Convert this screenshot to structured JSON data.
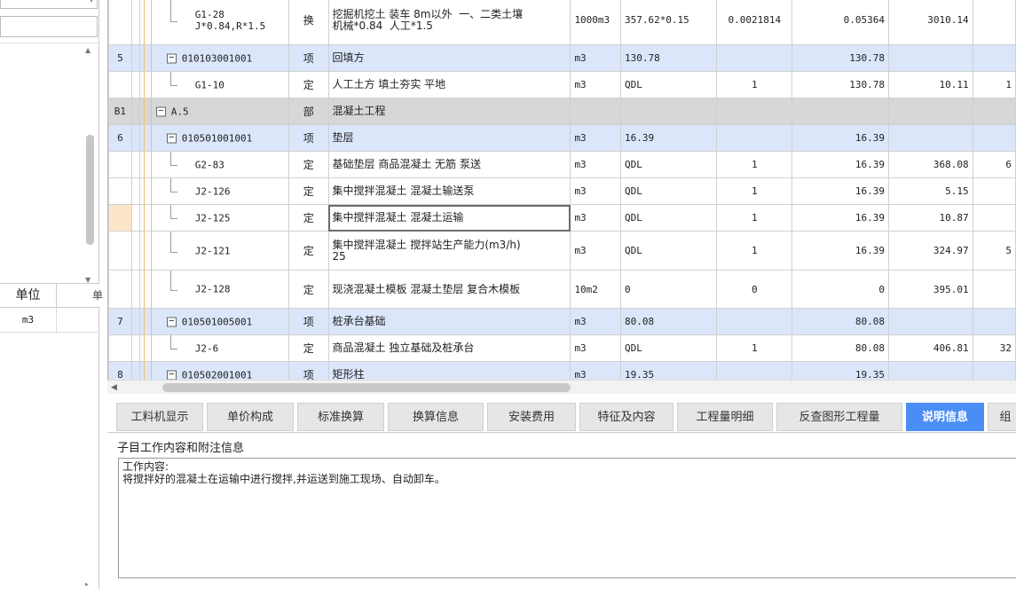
{
  "left_panel": {
    "header_unit": "单位",
    "header_second": "单",
    "row_unit": "m3"
  },
  "grid": {
    "rows": [
      {
        "idx": "",
        "code": "G1-28\nJ*0.84,R*1.5",
        "type": "换",
        "name": "挖掘机挖土 装车 8m以外  一、二类土壤\n机械*0.84  人工*1.5",
        "unit": "1000m3",
        "expr": "357.62*0.15",
        "coef": "0.0021814",
        "qty": "0.05364",
        "price": "3010.14",
        "extra": ""
      },
      {
        "idx": "5",
        "code": "010103001001",
        "type": "项",
        "name": "回填方",
        "unit": "m3",
        "expr": "130.78",
        "coef": "",
        "qty": "130.78",
        "price": "",
        "extra": ""
      },
      {
        "idx": "",
        "code": "G1-10",
        "type": "定",
        "name": "人工土方 填土夯实 平地",
        "unit": "m3",
        "expr": "QDL",
        "coef": "1",
        "qty": "130.78",
        "price": "10.11",
        "extra": "1"
      },
      {
        "idx": "B1",
        "code": "A.5",
        "type": "部",
        "name": "混凝土工程",
        "unit": "",
        "expr": "",
        "coef": "",
        "qty": "",
        "price": "",
        "extra": ""
      },
      {
        "idx": "6",
        "code": "010501001001",
        "type": "项",
        "name": "垫层",
        "unit": "m3",
        "expr": "16.39",
        "coef": "",
        "qty": "16.39",
        "price": "",
        "extra": ""
      },
      {
        "idx": "",
        "code": "G2-83",
        "type": "定",
        "name": "基础垫层 商品混凝土 无筋 泵送",
        "unit": "m3",
        "expr": "QDL",
        "coef": "1",
        "qty": "16.39",
        "price": "368.08",
        "extra": "6"
      },
      {
        "idx": "",
        "code": "J2-126",
        "type": "定",
        "name": "集中搅拌混凝土 混凝土输送泵",
        "unit": "m3",
        "expr": "QDL",
        "coef": "1",
        "qty": "16.39",
        "price": "5.15",
        "extra": ""
      },
      {
        "idx": "",
        "code": "J2-125",
        "type": "定",
        "name": "集中搅拌混凝土 混凝土运输",
        "unit": "m3",
        "expr": "QDL",
        "coef": "1",
        "qty": "16.39",
        "price": "10.87",
        "extra": ""
      },
      {
        "idx": "",
        "code": "J2-121",
        "type": "定",
        "name": "集中搅拌混凝土 搅拌站生产能力(m3/h)\n25",
        "unit": "m3",
        "expr": "QDL",
        "coef": "1",
        "qty": "16.39",
        "price": "324.97",
        "extra": "5"
      },
      {
        "idx": "",
        "code": "J2-128",
        "type": "定",
        "name": "现浇混凝土模板 混凝土垫层 复合木模板",
        "unit": "10m2",
        "expr": "0",
        "coef": "0",
        "qty": "0",
        "price": "395.01",
        "extra": ""
      },
      {
        "idx": "7",
        "code": "010501005001",
        "type": "项",
        "name": "桩承台基础",
        "unit": "m3",
        "expr": "80.08",
        "coef": "",
        "qty": "80.08",
        "price": "",
        "extra": ""
      },
      {
        "idx": "",
        "code": "J2-6",
        "type": "定",
        "name": "商品混凝土 独立基础及桩承台",
        "unit": "m3",
        "expr": "QDL",
        "coef": "1",
        "qty": "80.08",
        "price": "406.81",
        "extra": "32"
      },
      {
        "idx": "8",
        "code": "010502001001",
        "type": "项",
        "name": "矩形柱",
        "unit": "m3",
        "expr": "19.35",
        "coef": "",
        "qty": "19.35",
        "price": "",
        "extra": ""
      }
    ]
  },
  "tabs": [
    {
      "label": "工料机显示",
      "active": false
    },
    {
      "label": "单价构成",
      "active": false
    },
    {
      "label": "标准换算",
      "active": false
    },
    {
      "label": "换算信息",
      "active": false
    },
    {
      "label": "安装费用",
      "active": false
    },
    {
      "label": "特征及内容",
      "active": false
    },
    {
      "label": "工程量明细",
      "active": false
    },
    {
      "label": "反查图形工程量",
      "active": false
    },
    {
      "label": "说明信息",
      "active": true
    },
    {
      "label": "组",
      "active": false
    }
  ],
  "description": {
    "title": "子目工作内容和附注信息",
    "heading": "工作内容:",
    "body": "将搅拌好的混凝土在运输中进行搅拌,并运送到施工现场、自动卸车。"
  },
  "colors": {
    "item_row": "#dbe6fb",
    "part_row": "#d7d7d7",
    "active_tab": "#4a8ef5",
    "tree_line": "#f0c06a"
  }
}
